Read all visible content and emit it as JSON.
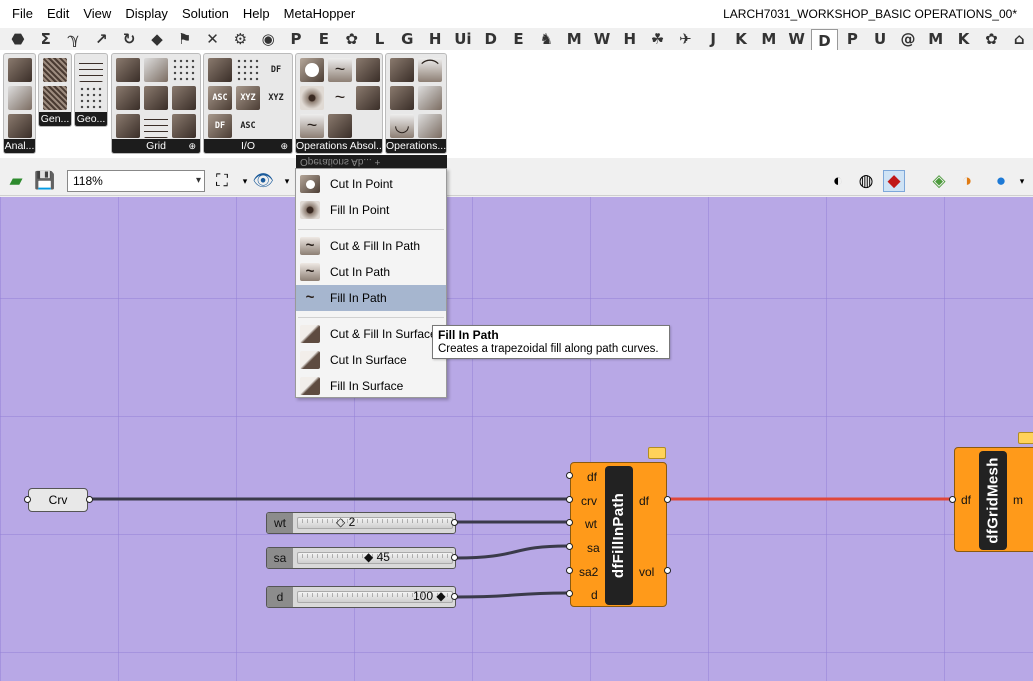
{
  "menu": [
    "File",
    "Edit",
    "View",
    "Display",
    "Solution",
    "Help",
    "MetaHopper"
  ],
  "document_title": "LARCH7031_WORKSHOP_BASIC OPERATIONS_00*",
  "tabs": [
    "⬣",
    "Σ",
    "ℽ",
    "↗",
    "↻",
    "◆",
    "⚑",
    "✕",
    "⚙",
    "◉",
    "P",
    "E",
    "✿",
    "L",
    "G",
    "H",
    "Ui",
    "D",
    "E",
    "♞",
    "M",
    "W",
    "H",
    "☘",
    "✈",
    "J",
    "K",
    "M",
    "W",
    "D",
    "P",
    "U",
    "@",
    "M",
    "K",
    "✿",
    "⌂"
  ],
  "active_tab_index": 29,
  "ribbon": {
    "panels": [
      {
        "label": "Anal..."
      },
      {
        "label": "Gen..."
      },
      {
        "label": "Geo..."
      },
      {
        "label": "Grid"
      },
      {
        "label": "I/O"
      },
      {
        "label": "Operations Absol..."
      },
      {
        "label": "Operations..."
      }
    ],
    "io_icons": [
      "ASC",
      "XYZ",
      "DF",
      "XYZ",
      "ASC",
      "DF"
    ]
  },
  "toolbar": {
    "zoom_value": "118%"
  },
  "dropdown": {
    "header": "Operations Ab... +",
    "groups": [
      [
        {
          "label": "Cut In Point",
          "icon": "point-cut-icon",
          "selected": false
        },
        {
          "label": "Fill In Point",
          "icon": "point-fill-icon",
          "selected": false
        }
      ],
      [
        {
          "label": "Cut & Fill In Path",
          "icon": "path-cutfill-icon",
          "selected": false
        },
        {
          "label": "Cut In Path",
          "icon": "path-cut-icon",
          "selected": false
        },
        {
          "label": "Fill In Path",
          "icon": "path-fill-icon",
          "selected": true
        }
      ],
      [
        {
          "label": "Cut & Fill In Surface",
          "icon": "surface-cutfill-icon",
          "selected": false
        },
        {
          "label": "Cut In Surface",
          "icon": "surface-cut-icon",
          "selected": false
        },
        {
          "label": "Fill In Surface",
          "icon": "surface-fill-icon",
          "selected": false
        }
      ]
    ]
  },
  "tooltip": {
    "title": "Fill In Path",
    "description": "Creates a trapezoidal fill along path curves."
  },
  "canvas": {
    "crv_param": "Crv",
    "sliders": [
      {
        "name": "wt",
        "value": "2"
      },
      {
        "name": "sa",
        "value": "45"
      },
      {
        "name": "d",
        "value": "100"
      }
    ],
    "component_fill_in_path": {
      "name": "dfFillInPath",
      "inputs": [
        "df",
        "crv",
        "wt",
        "sa",
        "sa2",
        "d"
      ],
      "outputs": [
        "df",
        "vol"
      ]
    },
    "component_grid_mesh": {
      "name": "dfGridMesh",
      "inputs": [
        "df"
      ],
      "outputs": [
        "m"
      ]
    }
  },
  "colors": {
    "canvas": "#b8a8e6",
    "component": "#ff9a1a",
    "selected_wire": "#e0473a",
    "menu_selected": "#a6b6cf"
  }
}
